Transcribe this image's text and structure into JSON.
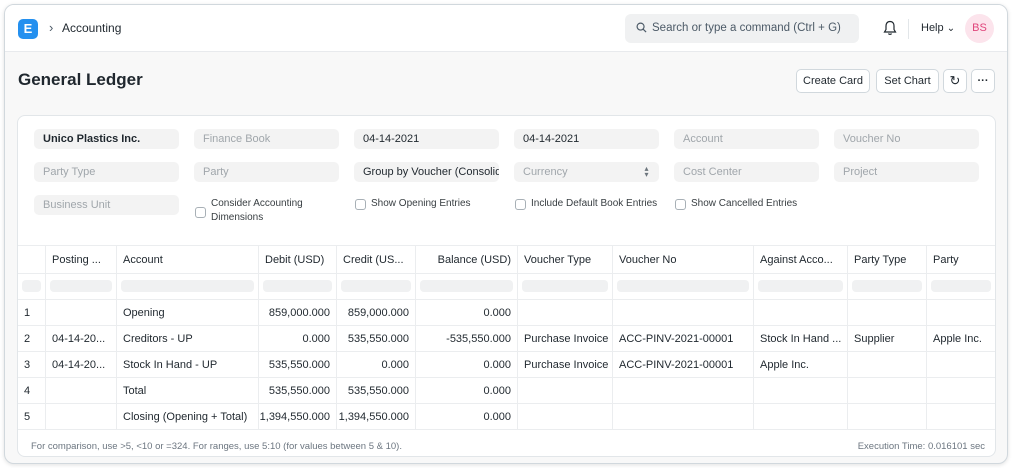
{
  "navbar": {
    "logo_letter": "E",
    "breadcrumb_chevron": "›",
    "breadcrumb": "Accounting",
    "search_placeholder": "Search or type a command (Ctrl + G)",
    "help_label": "Help",
    "help_caret": "⌄",
    "avatar_initials": "BS"
  },
  "page": {
    "title": "General Ledger",
    "create_card_label": "Create Card",
    "set_chart_label": "Set Chart",
    "refresh_icon": "↻",
    "more_icon": "···"
  },
  "filters": {
    "company": "Unico Plastics Inc.",
    "finance_book": "Finance Book",
    "from_date": "04-14-2021",
    "to_date": "04-14-2021",
    "account": "Account",
    "voucher_no": "Voucher No",
    "party_type": "Party Type",
    "party": "Party",
    "group_by": "Group by Voucher (Consolidated)",
    "currency": "Currency",
    "currency_caret": "▴▾",
    "cost_center": "Cost Center",
    "project": "Project",
    "business_unit": "Business Unit",
    "consider_dimensions": "Consider Accounting Dimensions",
    "show_opening": "Show Opening Entries",
    "include_default_book": "Include Default Book Entries",
    "show_cancelled": "Show Cancelled Entries"
  },
  "table": {
    "headers": [
      "",
      "Posting ...",
      "Account",
      "Debit (USD)",
      "Credit (US...",
      "Balance (USD)",
      "Voucher Type",
      "Voucher No",
      "Against Acco...",
      "Party Type",
      "Party"
    ],
    "rows": [
      [
        "1",
        "",
        "Opening",
        "859,000.000",
        "859,000.000",
        "0.000",
        "",
        "",
        "",
        "",
        ""
      ],
      [
        "2",
        "04-14-20...",
        "Creditors - UP",
        "0.000",
        "535,550.000",
        "-535,550.000",
        "Purchase Invoice",
        "ACC-PINV-2021-00001",
        "Stock In Hand ...",
        "Supplier",
        "Apple Inc."
      ],
      [
        "3",
        "04-14-20...",
        "Stock In Hand - UP",
        "535,550.000",
        "0.000",
        "0.000",
        "Purchase Invoice",
        "ACC-PINV-2021-00001",
        "Apple Inc.",
        "",
        ""
      ],
      [
        "4",
        "",
        "Total",
        "535,550.000",
        "535,550.000",
        "0.000",
        "",
        "",
        "",
        "",
        ""
      ],
      [
        "5",
        "",
        "Closing (Opening + Total)",
        "1,394,550.000",
        "1,394,550.000",
        "0.000",
        "",
        "",
        "",
        "",
        ""
      ]
    ]
  },
  "footer": {
    "hint": "For comparison, use >5, <10 or =324. For ranges, use 5:10 (for values between 5 & 10).",
    "execution_time": "Execution Time: 0.016101 sec"
  },
  "colors": {
    "brand": "#2490ef",
    "avatar_bg": "#fce4ec",
    "avatar_text": "#e0457b"
  }
}
